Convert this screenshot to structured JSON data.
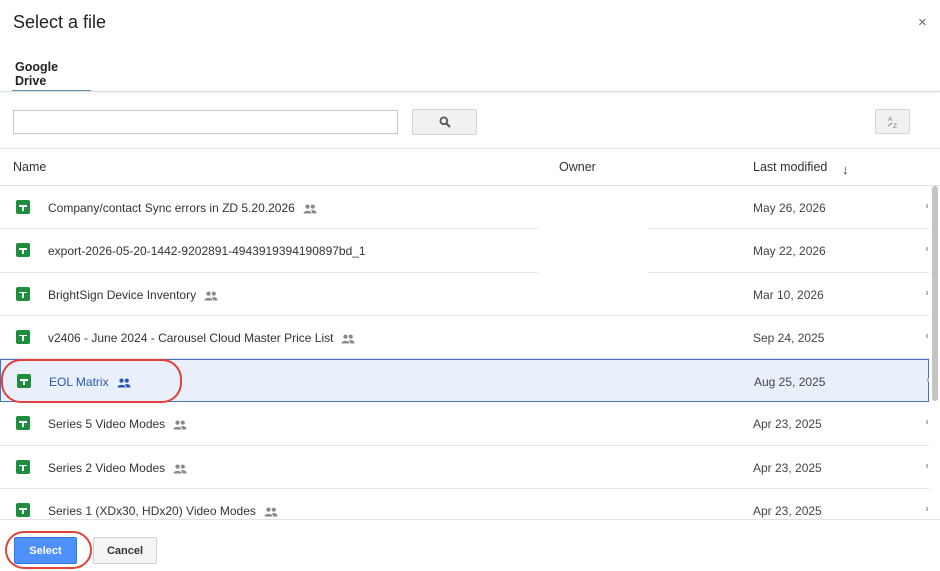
{
  "dialog": {
    "title": "Select a file",
    "close_icon": "×"
  },
  "tabs": [
    {
      "label": "Google Drive"
    }
  ],
  "search": {
    "value": "",
    "placeholder": ""
  },
  "table": {
    "columns": {
      "name": "Name",
      "owner": "Owner",
      "last_modified": "Last modified"
    },
    "sort_direction_icon": "↓",
    "rows": [
      {
        "name": "Company/contact Sync errors in ZD 5.20.2026",
        "shared": true,
        "date": "May 26, 2026"
      },
      {
        "name": "export-2026-05-20-1442-9202891-4943919394190897bd_1",
        "shared": false,
        "date": "May 22, 2026"
      },
      {
        "name": "BrightSign Device Inventory",
        "shared": true,
        "date": "Mar 10, 2026"
      },
      {
        "name": "v2406 - June 2024 - Carousel Cloud Master Price List",
        "shared": true,
        "date": "Sep 24, 2025"
      },
      {
        "name": "EOL Matrix",
        "shared": true,
        "date": "Aug 25, 2025",
        "selected": true
      },
      {
        "name": "Series 5 Video Modes",
        "shared": true,
        "date": "Apr 23, 2025"
      },
      {
        "name": "Series 2 Video Modes",
        "shared": true,
        "date": "Apr 23, 2025"
      },
      {
        "name": "Series 1 (XDx30, HDx20) Video Modes",
        "shared": true,
        "date": "Apr 23, 2025"
      }
    ]
  },
  "footer": {
    "select_label": "Select",
    "cancel_label": "Cancel"
  },
  "colors": {
    "accent": "#4d90fe",
    "sheet_icon": "#1e8e3e",
    "selected_row": "#e9f0fc",
    "highlight_ring": "#e0413a"
  }
}
